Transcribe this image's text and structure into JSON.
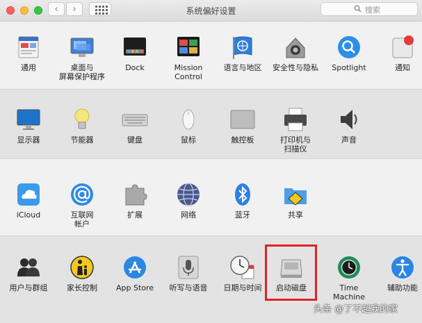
{
  "window": {
    "title": "系统偏好设置"
  },
  "toolbar": {
    "back_glyph": "‹",
    "forward_glyph": "›"
  },
  "search": {
    "placeholder": "搜索"
  },
  "sections": [
    {
      "items": [
        {
          "label": "通用",
          "icon": "general-icon"
        },
        {
          "label": "桌面与\n屏幕保护程序",
          "icon": "desktop-icon"
        },
        {
          "label": "Dock",
          "icon": "dock-icon"
        },
        {
          "label": "Mission\nControl",
          "icon": "mission-control-icon"
        },
        {
          "label": "语言与地区",
          "icon": "language-region-icon"
        },
        {
          "label": "安全性与隐私",
          "icon": "security-privacy-icon"
        },
        {
          "label": "Spotlight",
          "icon": "spotlight-icon"
        },
        {
          "label": "通知",
          "icon": "notifications-icon"
        }
      ]
    },
    {
      "items": [
        {
          "label": "显示器",
          "icon": "displays-icon"
        },
        {
          "label": "节能器",
          "icon": "energy-saver-icon"
        },
        {
          "label": "键盘",
          "icon": "keyboard-icon"
        },
        {
          "label": "鼠标",
          "icon": "mouse-icon"
        },
        {
          "label": "触控板",
          "icon": "trackpad-icon"
        },
        {
          "label": "打印机与\n扫描仪",
          "icon": "printer-icon"
        },
        {
          "label": "声音",
          "icon": "sound-icon"
        }
      ]
    },
    {
      "items": [
        {
          "label": "iCloud",
          "icon": "icloud-icon"
        },
        {
          "label": "互联网\n帐户",
          "icon": "internet-accounts-icon"
        },
        {
          "label": "扩展",
          "icon": "extensions-icon"
        },
        {
          "label": "网络",
          "icon": "network-icon"
        },
        {
          "label": "蓝牙",
          "icon": "bluetooth-icon"
        },
        {
          "label": "共享",
          "icon": "sharing-icon"
        }
      ]
    },
    {
      "items": [
        {
          "label": "用户与群组",
          "icon": "users-groups-icon"
        },
        {
          "label": "家长控制",
          "icon": "parental-controls-icon"
        },
        {
          "label": "App Store",
          "icon": "app-store-icon"
        },
        {
          "label": "听写与语音",
          "icon": "dictation-speech-icon"
        },
        {
          "label": "日期与时间",
          "icon": "date-time-icon"
        },
        {
          "label": "启动磁盘",
          "icon": "startup-disk-icon"
        },
        {
          "label": "Time Machine",
          "icon": "time-machine-icon"
        },
        {
          "label": "辅助功能",
          "icon": "accessibility-icon"
        }
      ]
    }
  ],
  "watermark": "头条 @了不起我的家",
  "colors": {
    "highlight": "#e12323",
    "close": "#fc605c",
    "minimize": "#fdbc40",
    "zoom": "#34c84a"
  }
}
